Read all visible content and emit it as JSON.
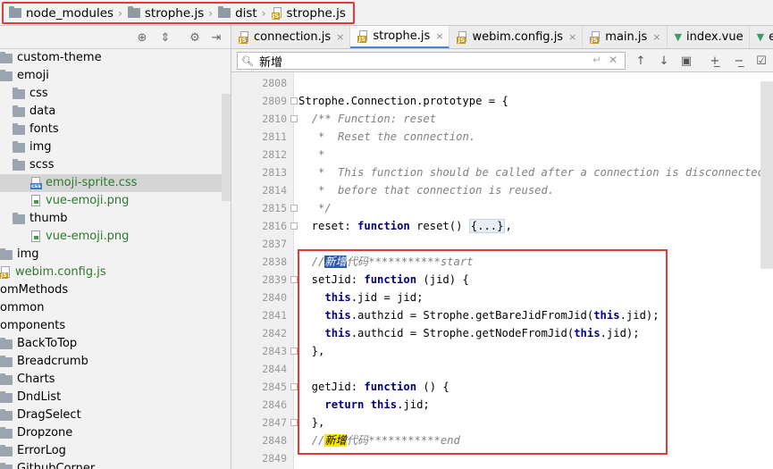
{
  "breadcrumb": {
    "items": [
      {
        "label": "node_modules",
        "type": "folder"
      },
      {
        "label": "strophe.js",
        "type": "folder"
      },
      {
        "label": "dist",
        "type": "folder"
      },
      {
        "label": "strophe.js",
        "type": "js-file"
      }
    ]
  },
  "project_tree": {
    "toolbar_icons": [
      "crosshair-icon",
      "collapse-all-icon",
      "gear-icon",
      "hide-icon"
    ],
    "rows": [
      {
        "label": "custom-theme",
        "kind": "folder",
        "indent": 0
      },
      {
        "label": "emoji",
        "kind": "folder",
        "indent": 0
      },
      {
        "label": "css",
        "kind": "folder",
        "indent": 1
      },
      {
        "label": "data",
        "kind": "folder",
        "indent": 1
      },
      {
        "label": "fonts",
        "kind": "folder",
        "indent": 1
      },
      {
        "label": "img",
        "kind": "folder",
        "indent": 1
      },
      {
        "label": "scss",
        "kind": "folder",
        "indent": 1
      },
      {
        "label": "emoji-sprite.css",
        "kind": "css",
        "indent": 2,
        "selected": true
      },
      {
        "label": "vue-emoji.png",
        "kind": "png",
        "indent": 2
      },
      {
        "label": "thumb",
        "kind": "folder",
        "indent": 1
      },
      {
        "label": "vue-emoji.png",
        "kind": "png",
        "indent": 2
      },
      {
        "label": "img",
        "kind": "folder",
        "indent": 0
      },
      {
        "label": "webim.config.js",
        "kind": "js",
        "indent": 0
      },
      {
        "label": "omMethods",
        "kind": "text",
        "indent": 0
      },
      {
        "label": "ommon",
        "kind": "text",
        "indent": 0
      },
      {
        "label": "omponents",
        "kind": "text",
        "indent": 0
      },
      {
        "label": "BackToTop",
        "kind": "folder",
        "indent": 0
      },
      {
        "label": "Breadcrumb",
        "kind": "folder",
        "indent": 0
      },
      {
        "label": "Charts",
        "kind": "folder",
        "indent": 0
      },
      {
        "label": "DndList",
        "kind": "folder",
        "indent": 0
      },
      {
        "label": "DragSelect",
        "kind": "folder",
        "indent": 0
      },
      {
        "label": "Dropzone",
        "kind": "folder",
        "indent": 0
      },
      {
        "label": "ErrorLog",
        "kind": "folder",
        "indent": 0
      },
      {
        "label": "GithubCorner",
        "kind": "folder",
        "indent": 0
      }
    ]
  },
  "tabs": [
    {
      "label": "connection.js",
      "icon": "js",
      "active": false
    },
    {
      "label": "strophe.js",
      "icon": "js",
      "active": true
    },
    {
      "label": "webim.config.js",
      "icon": "js",
      "active": false
    },
    {
      "label": "main.js",
      "icon": "js",
      "active": false
    },
    {
      "label": "index.vue",
      "icon": "vue",
      "active": false
    },
    {
      "label": "emo",
      "icon": "vue",
      "active": false
    }
  ],
  "find": {
    "query": "新增",
    "icons": [
      "search-icon",
      "enter-icon",
      "clear-icon",
      "prev-occurrence-icon",
      "next-occurrence-icon",
      "select-all-icon",
      "add-selection-icon",
      "remove-selection-icon",
      "filter-icon"
    ]
  },
  "editor": {
    "lines": [
      {
        "num": "2808",
        "html": ""
      },
      {
        "num": "2809",
        "html": "Strophe.Connection.prototype = {"
      },
      {
        "num": "2810",
        "html": "  <span class=\"cm\">/** Function: reset</span>"
      },
      {
        "num": "2811",
        "html": "   <span class=\"cm\">*  Reset the connection.</span>"
      },
      {
        "num": "2812",
        "html": "   <span class=\"cm\">*</span>"
      },
      {
        "num": "2813",
        "html": "   <span class=\"cm\">*  This function should be called after a connection is disconnected</span>"
      },
      {
        "num": "2814",
        "html": "   <span class=\"cm\">*  before that connection is reused.</span>"
      },
      {
        "num": "2815",
        "html": "   <span class=\"cm\">*/</span>"
      },
      {
        "num": "2816",
        "html": "  reset: <span class=\"kw\">function</span> reset() <span class=\"fold-box\">{...}</span>,"
      },
      {
        "num": "2837",
        "html": ""
      },
      {
        "num": "2838",
        "html": "  <span class=\"cm\">//<span class=\"hl-sel\">新增</span>代码***********start</span>"
      },
      {
        "num": "2839",
        "html": "  setJid: <span class=\"kw\">function</span> (jid) {"
      },
      {
        "num": "2840",
        "html": "    <span class=\"kw\">this</span>.jid = jid;"
      },
      {
        "num": "2841",
        "html": "    <span class=\"kw\">this</span>.authzid = Strophe.getBareJidFromJid(<span class=\"kw\">this</span>.jid);"
      },
      {
        "num": "2842",
        "html": "    <span class=\"kw\">this</span>.authcid = Strophe.getNodeFromJid(<span class=\"kw\">this</span>.jid);"
      },
      {
        "num": "2843",
        "html": "  },"
      },
      {
        "num": "2844",
        "html": ""
      },
      {
        "num": "2845",
        "html": "  getJid: <span class=\"kw\">function</span> () {"
      },
      {
        "num": "2846",
        "html": "    <span class=\"kw\">return this</span>.jid;"
      },
      {
        "num": "2847",
        "html": "  },"
      },
      {
        "num": "2848",
        "html": "  <span class=\"cm\">//<span class=\"hl-yel\">新增</span>代码***********end</span>"
      },
      {
        "num": "2849",
        "html": ""
      }
    ]
  }
}
